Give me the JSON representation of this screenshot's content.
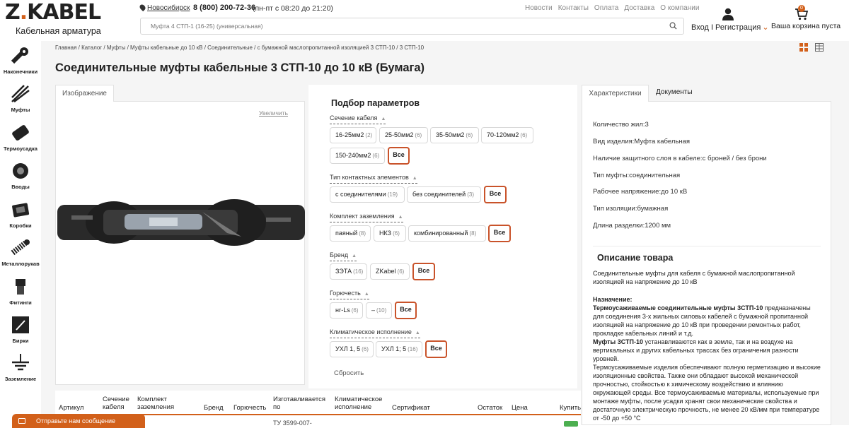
{
  "header": {
    "logo": "ZKABEL",
    "logo_sub": "Кабельная арматура",
    "city": "Новосибирск",
    "phone": "8 (800) 200-72-36",
    "hours": "(пн-пт с 08:20 до 21:20)",
    "nav": [
      "Новости",
      "Контакты",
      "Оплата",
      "Доставка",
      "О компании"
    ],
    "search_placeholder": "Муфта 4 СТП-1 (16-25) (универсальная)",
    "login": "Вход I Регистрация",
    "cart_count": "0",
    "cart_text": "Ваша корзина пуста"
  },
  "sidebar": [
    {
      "label": "Наконечники",
      "icon": "lug-icon"
    },
    {
      "label": "Муфты",
      "icon": "sleeve-icon"
    },
    {
      "label": "Термоусадка",
      "icon": "heatshrink-icon"
    },
    {
      "label": "Вводы",
      "icon": "gland-icon"
    },
    {
      "label": "Коробки",
      "icon": "box-icon"
    },
    {
      "label": "Металлорукав",
      "icon": "metal-hose-icon"
    },
    {
      "label": "Фитинги",
      "icon": "fitting-icon"
    },
    {
      "label": "Бирки",
      "icon": "tag-icon"
    },
    {
      "label": "Заземление",
      "icon": "ground-icon"
    }
  ],
  "breadcrumb": "Главная / Каталог / Муфты / Муфты кабельные до 10 кВ / Соединительные / с бумажной маслопропитанной изоляцией 3 СТП-10 / 3 СТП-10",
  "title": "Соединительные муфты кабельные 3 СТП-10 до 10 кВ (Бумага)",
  "image_tab": "Изображение",
  "zoom": "Увеличить",
  "params": {
    "title": "Подбор параметров",
    "groups": [
      {
        "title": "Сечение кабеля",
        "chips": [
          {
            "label": "16-25мм2",
            "count": "(2)"
          },
          {
            "label": "25-50мм2",
            "count": "(6)"
          },
          {
            "label": "35-50мм2",
            "count": "(6)"
          },
          {
            "label": "70-120мм2",
            "count": "(6)"
          },
          {
            "label": "150-240мм2",
            "count": "(6)"
          }
        ]
      },
      {
        "title": "Тип контактных элементов",
        "chips": [
          {
            "label": "с соединителями",
            "count": "(19)"
          },
          {
            "label": "без соединителей",
            "count": "(3)"
          }
        ]
      },
      {
        "title": "Комплект заземления",
        "chips": [
          {
            "label": "паяный",
            "count": "(8)"
          },
          {
            "label": "НКЗ",
            "count": "(6)"
          },
          {
            "label": "комбинированный",
            "count": "(8)"
          }
        ]
      },
      {
        "title": "Бренд",
        "chips": [
          {
            "label": "ЗЭТА",
            "count": "(16)"
          },
          {
            "label": "ZKabel",
            "count": "(6)"
          }
        ]
      },
      {
        "title": "Горючесть",
        "chips": [
          {
            "label": "нг-Ls",
            "count": "(6)"
          },
          {
            "label": "–",
            "count": "(10)"
          }
        ]
      },
      {
        "title": "Климатическое исполнение",
        "chips": [
          {
            "label": "УХЛ 1, 5",
            "count": "(6)"
          },
          {
            "label": "УХЛ 1; 5",
            "count": "(16)"
          }
        ]
      }
    ],
    "all_label": "Все",
    "reset": "Сбросить"
  },
  "tabs": {
    "characteristics": "Характеристики",
    "documents": "Документы"
  },
  "characteristics": [
    "Количество жил:3",
    "Вид изделия:Муфта кабельная",
    "Наличие защитного слоя в кабеле:с броней / без брони",
    "Тип муфты:соединительная",
    "Рабочее напряжение:до 10 кВ",
    "Тип изоляции:бумажная",
    "Длина разделки:1200 мм"
  ],
  "description": {
    "title": "Описание товара",
    "intro": "Соединительные муфты для кабеля с бумажной маслопропитанной изоляцией на напряжение до 10 кВ",
    "purpose_label": "Назначение:",
    "p1_bold": "Термоусаживаемые соединительные муфты 3СТП-10",
    "p1": " предназначены для соединения 3-х жильных силовых кабелей с бумажной пропитанной изоляцией на напряжение до 10 кВ при проведении ремонтных работ, прокладке кабельных линий и т.д.",
    "p2_bold": "Муфты 3СТП-10",
    "p2": " устанавливаются как в земле, так и на воздухе на вертикальных и других кабельных трассах без ограничения разности уровней.",
    "p3": "Термоусаживаемые изделия обеспечивают полную герметизацию и высокие изоляционные свойства. Также они обладают высокой механической прочностью, стойкостью к химическому воздействию и влиянию окружающей среды. Все термоусаживаемые материалы, используемые при монтаже муфты, после усадки хранят свои механические свойства и достаточную электрическую прочность, не менее 20 кВ/мм при температуре от -50 до +50 °С"
  },
  "table": {
    "headers": [
      "Артикул",
      "Сечение кабеля",
      "Комплект заземления",
      "Бренд",
      "Горючесть",
      "Изготавливается по",
      "Климатическое исполнение",
      "Сертификат",
      "Остаток",
      "Цена",
      "Купить"
    ],
    "row_fragment": "ТУ 3599-007-"
  },
  "message": "Отправьте нам сообщение",
  "colors": {
    "accent": "#d2601a",
    "all_border": "#c9532a",
    "buy": "#4caf50"
  }
}
